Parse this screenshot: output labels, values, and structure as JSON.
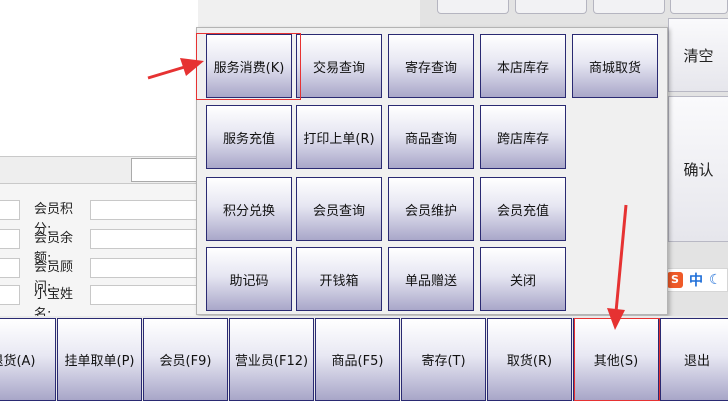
{
  "popup_menu": {
    "rows": [
      [
        "服务消费(K)",
        "交易查询",
        "寄存查询",
        "本店库存",
        "商城取货"
      ],
      [
        "服务充值",
        "打印上单(R)",
        "商品查询",
        "跨店库存"
      ],
      [
        "积分兑换",
        "会员查询",
        "会员维护",
        "会员充值"
      ],
      [
        "助记码",
        "开钱箱",
        "单品赠送",
        "关闭"
      ]
    ]
  },
  "member_form": {
    "labels": [
      "会员积分:",
      "会员余额:",
      "会员顾问:",
      "小宝姓名:"
    ]
  },
  "side_keys": {
    "clear": "清空",
    "confirm": "确认"
  },
  "bottom_bar": [
    "退货(A)",
    "挂单取单(P)",
    "会员(F9)",
    "营业员(F12)",
    "商品(F5)",
    "寄存(T)",
    "取货(R)",
    "其他(S)",
    "退出"
  ],
  "ime": {
    "lang": "中"
  },
  "colors": {
    "key_border": "#2a2a72",
    "annotation": "#e63232"
  }
}
